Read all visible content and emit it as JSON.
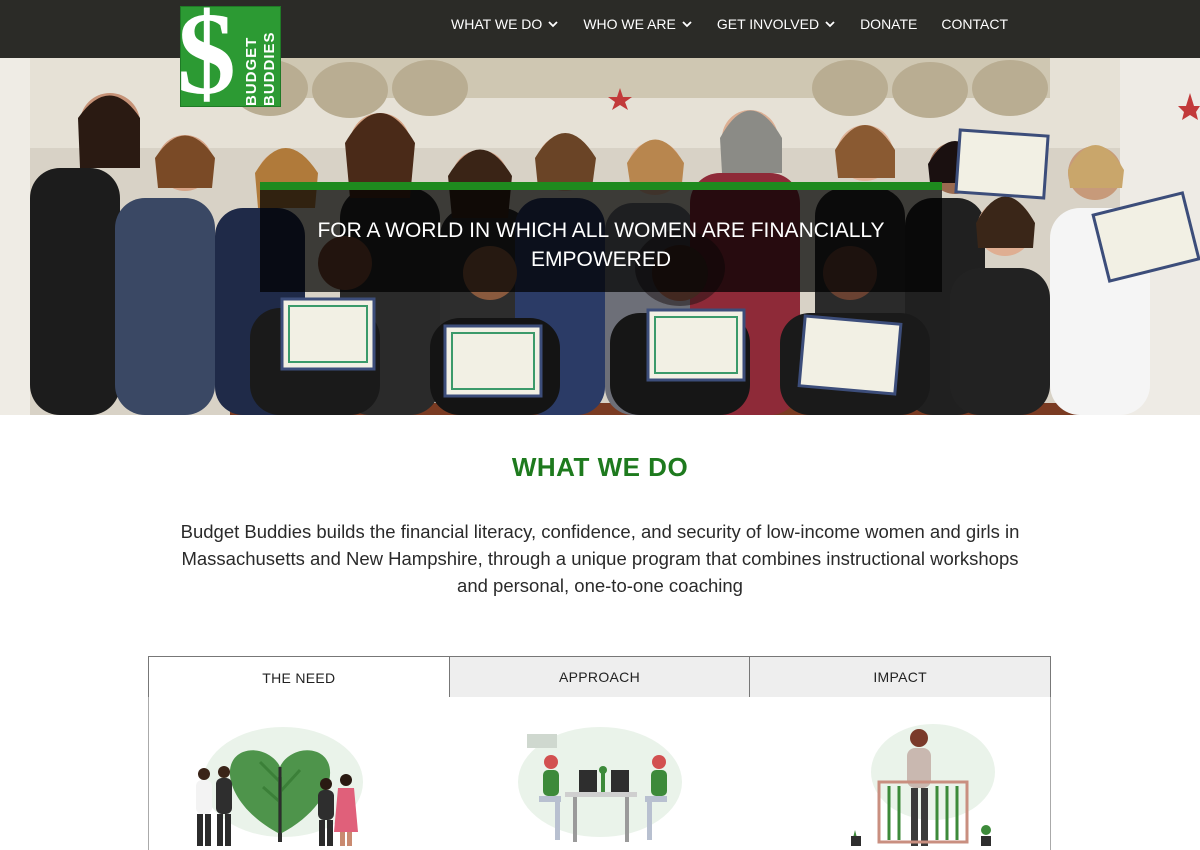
{
  "logo": {
    "line1": "BUDGET",
    "line2": "BUDDIES",
    "symbol": "$"
  },
  "nav": {
    "items": [
      {
        "label": "WHAT WE DO",
        "dropdown": true
      },
      {
        "label": "WHO WE ARE",
        "dropdown": true
      },
      {
        "label": "GET INVOLVED",
        "dropdown": true
      },
      {
        "label": "DONATE",
        "dropdown": false
      },
      {
        "label": "CONTACT",
        "dropdown": false
      }
    ]
  },
  "hero": {
    "tagline": "FOR A WORLD IN WHICH ALL WOMEN ARE FINANCIALLY EMPOWERED"
  },
  "what_we_do": {
    "title": "WHAT WE DO",
    "description": "Budget Buddies builds the financial literacy, confidence, and security of low-income women and girls in Massachusetts and New Hampshire, through a unique program that combines instructional workshops and personal, one-to-one coaching"
  },
  "tabs": [
    {
      "label": "THE NEED",
      "active": true
    },
    {
      "label": "APPROACH",
      "active": false
    },
    {
      "label": "IMPACT",
      "active": false
    }
  ],
  "colors": {
    "brand_green": "#2c9a33",
    "title_green": "#1e7a1e",
    "nav_bg": "#2b2b27"
  }
}
